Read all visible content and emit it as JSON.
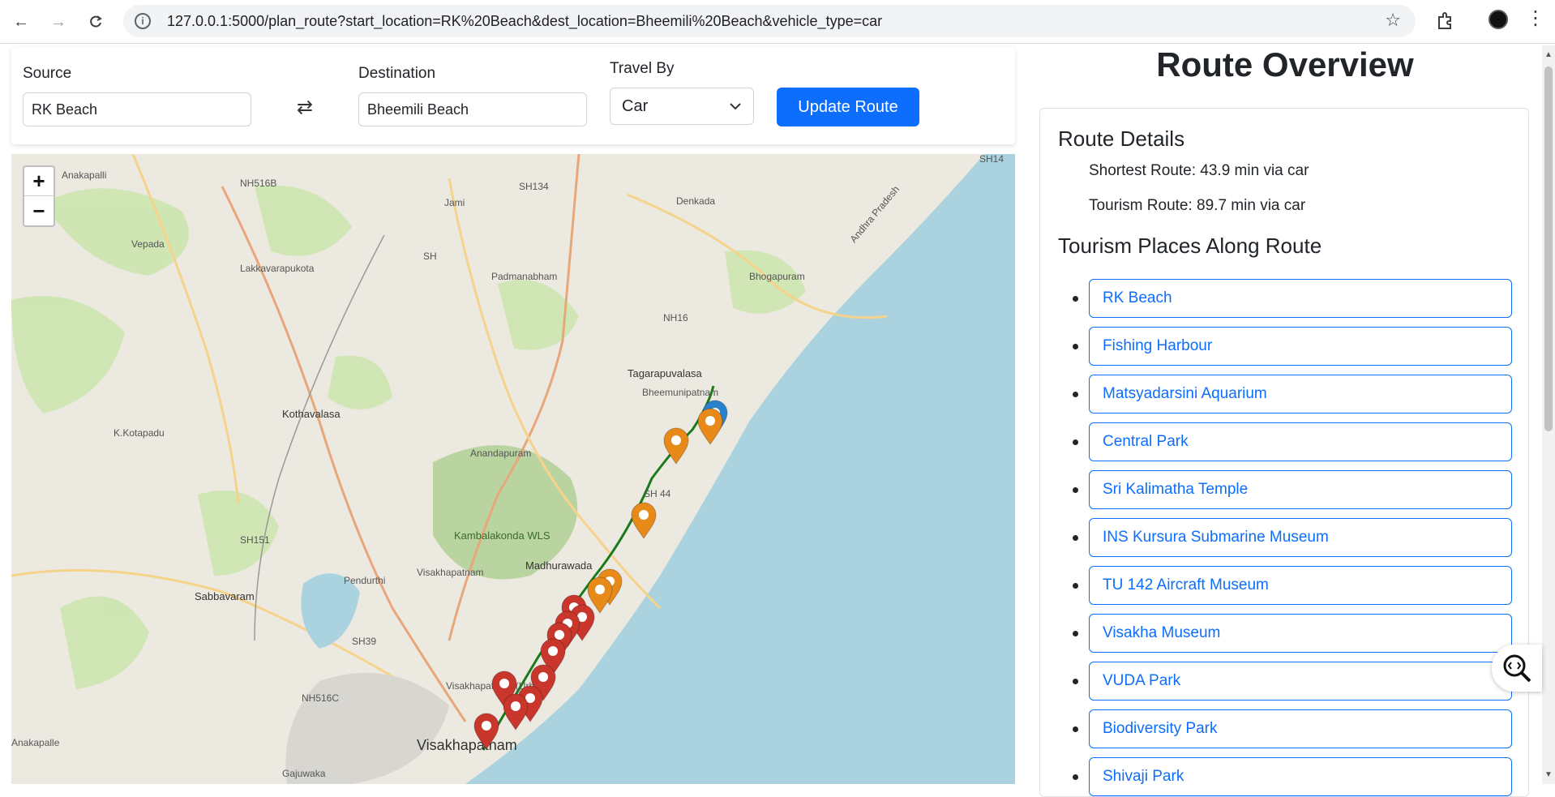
{
  "browser": {
    "url": "127.0.0.1:5000/plan_route?start_location=RK%20Beach&dest_location=Bheemili%20Beach&vehicle_type=car"
  },
  "form": {
    "source_label": "Source",
    "source_value": "RK Beach",
    "destination_label": "Destination",
    "destination_value": "Bheemili Beach",
    "travel_label": "Travel By",
    "travel_value": "Car",
    "update_label": "Update Route"
  },
  "map": {
    "zoom_in": "+",
    "zoom_out": "−",
    "labels": [
      "Anakapalli",
      "NH516B",
      "SH134",
      "Jami",
      "Denkada",
      "Vepada",
      "Lakkavarapukota",
      "SH",
      "Padmanabham",
      "Bhogapuram",
      "Andhra Pradesh",
      "NH16",
      "Tagarapuvalasa",
      "Bheemunipatnam",
      "Kothavalasa",
      "K.Kotapadu",
      "Anandapuram",
      "SH 44",
      "Kambalakonda WLS",
      "Madhurawada",
      "SH151",
      "Pendurthi",
      "Visakhapatnam",
      "Sabbavaram",
      "SH39",
      "NH516C",
      "Visakhapatnam (Urban)",
      "Anakapalle",
      "Gajuwaka",
      "SH14"
    ]
  },
  "panel": {
    "title": "Route Overview",
    "details_heading": "Route Details",
    "shortest": "Shortest Route: 43.9 min via car",
    "tourism": "Tourism Route: 89.7 min via car",
    "places_heading": "Tourism Places Along Route",
    "places": [
      "RK Beach",
      "Fishing Harbour",
      "Matsyadarsini Aquarium",
      "Central Park",
      "Sri Kalimatha Temple",
      "INS Kursura Submarine Museum",
      "TU 142 Aircraft Museum",
      "Visakha Museum",
      "VUDA Park",
      "Biodiversity Park",
      "Shivaji Park"
    ]
  },
  "colors": {
    "primary": "#0d6efd",
    "route_line": "#1b7a1b",
    "marker_red": "#c9372c",
    "marker_orange": "#e88a1a",
    "marker_blue": "#2a81cb",
    "sea": "#aad3df"
  }
}
